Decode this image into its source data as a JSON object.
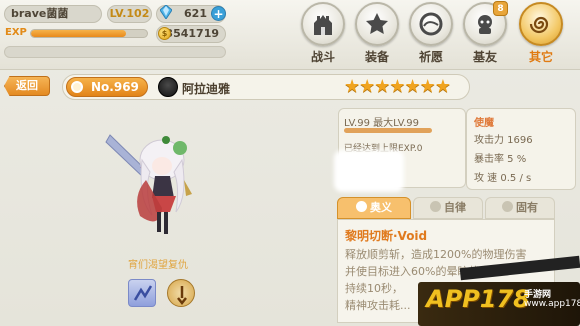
{
  "player": {
    "name": "brave菌菌",
    "level": "LV.102",
    "gems": "621",
    "exp_label": "EXP",
    "exp_progress": 0.82,
    "gold": "3541719"
  },
  "nav": [
    {
      "label": "战斗",
      "icon": "castle-icon"
    },
    {
      "label": "装备",
      "icon": "star-shield-icon"
    },
    {
      "label": "祈愿",
      "icon": "orb-icon"
    },
    {
      "label": "基友",
      "icon": "friend-icon",
      "badge": "8"
    },
    {
      "label": "其它",
      "icon": "spiral-icon"
    }
  ],
  "header": {
    "back_label": "返回",
    "number": "No.969",
    "hero_name": "阿拉迪雅",
    "stars": "★★★★★★★",
    "star_count": 7
  },
  "character": {
    "quote": "宵们渴望复仇"
  },
  "level_panel": {
    "level_text": "LV.99 最大LV.99",
    "exp_text": "已经达到上限EXP.0"
  },
  "stats": {
    "title": "使魔",
    "attack": "攻击力 1696",
    "crit": "暴击率 5 %",
    "speed": "攻  速 0.5 / s"
  },
  "tabs": [
    {
      "label": "奥义"
    },
    {
      "label": "自律"
    },
    {
      "label": "固有"
    }
  ],
  "skill": {
    "name": "黎明切断·Void",
    "desc_line1": "释放顺剪斩，造成1200%的物理伤害",
    "desc_line2": "并使目标进入60%的晕眩状态",
    "desc_line3": "持续10秒，",
    "desc_line4": "精神攻击耗..."
  },
  "watermark": {
    "text": "APP178",
    "sub": "手游网",
    "url": "www.app178.com"
  },
  "colors": {
    "accent": "#e28418",
    "background": "#e9e8df",
    "star": "#f0a420"
  }
}
